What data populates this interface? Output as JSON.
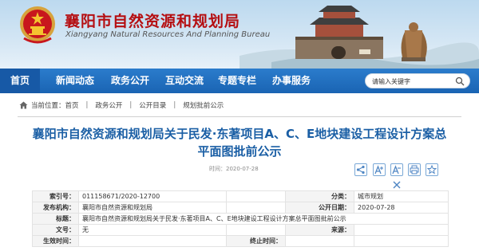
{
  "header": {
    "title": "襄阳市自然资源和规划局",
    "subtitle": "Xiangyang Natural Resources And Planning Bureau"
  },
  "nav": {
    "items": [
      {
        "label": "首页"
      },
      {
        "label": "新闻动态"
      },
      {
        "label": "政务公开"
      },
      {
        "label": "互动交流"
      },
      {
        "label": "专题专栏"
      },
      {
        "label": "办事服务"
      }
    ]
  },
  "search": {
    "placeholder": "请输入关键字"
  },
  "breadcrumb": {
    "prefix": "当前位置：",
    "items": [
      "首页",
      "政务公开",
      "公开目录",
      "规划批前公示"
    ]
  },
  "article": {
    "title": "襄阳市自然资源和规划局关于民发·东著项目A、C、E地块建设工程设计方案总平面图批前公示",
    "time_label": "时间：",
    "time": "2020-07-28"
  },
  "meta": {
    "index_no_label": "索引号：",
    "index_no": "011158671/2020-12700",
    "category_label": "分类：",
    "category": "城市规划",
    "publisher_label": "发布机构：",
    "publisher": "襄阳市自然资源和规划局",
    "date_label": "公开日期：",
    "date": "2020-07-28",
    "title_label": "标题：",
    "title": "襄阳市自然资源和规划局关于民发·东著项目A、C、E地块建设工程设计方案总平面图批前公示",
    "doc_no_label": "文号：",
    "doc_no": "无",
    "source_label": "来源：",
    "source": "",
    "effective_label": "生效时间：",
    "effective": "",
    "expire_label": "终止时间：",
    "expire": ""
  },
  "colors": {
    "brand_red": "#b50f12",
    "nav_blue": "#1a64b3",
    "title_blue": "#1b5fa5"
  },
  "icons": [
    "emblem",
    "home-icon",
    "search-icon",
    "share-icon",
    "font-larger-icon",
    "font-smaller-icon",
    "print-icon",
    "favorite-icon",
    "close-icon"
  ]
}
